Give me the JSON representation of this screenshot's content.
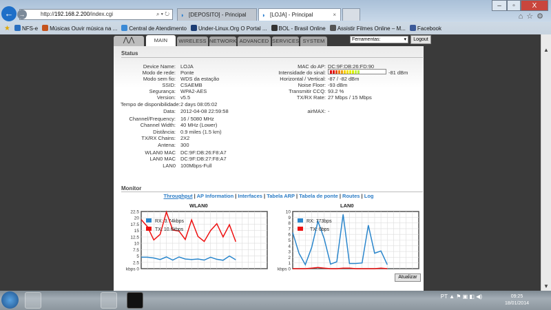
{
  "browser": {
    "url_prefix": "http://",
    "url_host": "192.168.2.200",
    "url_path": "/index.cgi",
    "search_icons": "⌕ ▾ ↻",
    "tabs": [
      {
        "label": "[DEPOSITO] - Principal"
      },
      {
        "label": "[LOJA] - Principal",
        "close": "×"
      }
    ],
    "window_buttons": {
      "min": "–",
      "max": "▫",
      "close": "X"
    },
    "right_icons": "⌂☆⚙",
    "favorites": [
      {
        "label": "NFS-e",
        "color": "#2a6fc0"
      },
      {
        "label": "Músicas Ouvir música na ...",
        "color": "#c4531c"
      },
      {
        "label": "Central de Atendimento",
        "color": "#3b8ad6"
      },
      {
        "label": "Under-Linux.Org O Portal ...",
        "color": "#1c3d74"
      },
      {
        "label": "BOL - Brasil Online",
        "color": "#333"
      },
      {
        "label": "Assistir Filmes Online – M...",
        "color": "#555"
      },
      {
        "label": "Facebook",
        "color": "#3b5998"
      }
    ]
  },
  "nav": {
    "logo": "⋀⋀",
    "tabs": [
      "MAIN",
      "WIRELESS",
      "NETWORK",
      "ADVANCED",
      "SERVICES",
      "SYSTEM"
    ],
    "tools_select": "Ferramentas:",
    "logout": "Logout"
  },
  "status": {
    "title": "Status",
    "left": [
      [
        "Device Name:",
        "LOJA"
      ],
      [
        "Modo de rede:",
        "Ponte"
      ],
      [
        "Modo sem fio:",
        "WDS da estação"
      ],
      [
        "SSID:",
        "CSAEMB"
      ],
      [
        "Segurança:",
        "WPA2-AES"
      ],
      [
        "Version:",
        "v5.5"
      ],
      [
        "Tempo de disponibilidade:",
        "2 days 08:05:02"
      ],
      [
        "Data:",
        "2012-04-08 22:59:58"
      ],
      [
        "Channel/Frequency:",
        "16 / 5080 MHz"
      ],
      [
        "Channel Width:",
        "40 MHz (Lower)"
      ],
      [
        "Distância:",
        "0.9 miles (1.5 km)"
      ],
      [
        "TX/RX Chains:",
        "2X2"
      ],
      [
        "Antena:",
        "300"
      ],
      [
        "WLAN0 MAC",
        "DC:9F:DB:26:F8:A7"
      ],
      [
        "LAN0 MAC",
        "DC:9F:DB:27:F8:A7"
      ],
      [
        "LAN0",
        "100Mbps-Full"
      ]
    ],
    "right": [
      [
        "MAC do AP:",
        "DC:9F:DB:26:FD:90"
      ],
      [
        "Intensidade do sinal:",
        "-81 dBm"
      ],
      [
        "Horizontal / Vertical:",
        "-87 / -82 dBm"
      ],
      [
        "Noise Floor:",
        "-93 dBm"
      ],
      [
        "Transmitir CCQ:",
        "93.2 %"
      ],
      [
        "TX/RX Rate:",
        "27 Mbps / 15 Mbps"
      ],
      [
        "airMAX:",
        "-"
      ]
    ],
    "signal_level": 0.45
  },
  "monitor": {
    "title": "Monitor",
    "links": [
      "Throughput",
      "AP Information",
      "Interfaces",
      "Tabela ARP",
      "Tabela de ponte",
      "Routes",
      "Log"
    ],
    "refresh": "Atualizar"
  },
  "chart_data": [
    {
      "type": "line",
      "title": "WLAN0",
      "ylabel": "kbps",
      "ylim": [
        0,
        22.5
      ],
      "yticks": [
        "kbps 0",
        "2.5",
        "5",
        "7.5",
        "10",
        "12.5",
        "15",
        "17.5",
        "20",
        "22.5"
      ],
      "grid": true,
      "legend": "top-left",
      "series": [
        {
          "name": "RX: 3.74kbps",
          "color": "#2a86cc",
          "values": [
            4.5,
            4.5,
            4.2,
            3.6,
            4.6,
            3.4,
            4.6,
            3.8,
            3.6,
            3.8,
            3.4,
            4.5,
            3.7,
            3.3,
            5.0,
            3.5
          ]
        },
        {
          "name": "TX: 10.6kbps",
          "color": "#ee1111",
          "values": [
            19.3,
            16.5,
            11.3,
            13.5,
            22.3,
            15.2,
            14.8,
            11.5,
            19.2,
            12.7,
            10.7,
            15.0,
            17.7,
            12.5,
            17.3,
            10.6
          ]
        }
      ]
    },
    {
      "type": "line",
      "title": "LAN0",
      "ylabel": "kbps",
      "ylim": [
        0,
        10
      ],
      "yticks": [
        "kbps 0",
        "1",
        "2",
        "3",
        "4",
        "5",
        "6",
        "7",
        "8",
        "9",
        "10"
      ],
      "grid": true,
      "legend": "top-left",
      "series": [
        {
          "name": "RX: 773bps",
          "color": "#2a86cc",
          "values": [
            6.3,
            2.7,
            0.7,
            3.7,
            8.3,
            5.2,
            0.8,
            1.2,
            9.5,
            0.9,
            0.9,
            1.0,
            7.6,
            2.7,
            3.1,
            0.7
          ]
        },
        {
          "name": "TX: 0bps",
          "color": "#ee1111",
          "values": [
            0,
            0,
            0,
            0.1,
            0.2,
            0.1,
            0,
            0,
            0.1,
            0.1,
            0,
            0,
            0,
            0,
            0.1,
            0
          ]
        }
      ]
    }
  ],
  "taskbar": {
    "lang": "PT",
    "tray": "▲ ⚑ ▣ ◧ ◀)",
    "time": "09:25",
    "date": "18/01/2014"
  }
}
